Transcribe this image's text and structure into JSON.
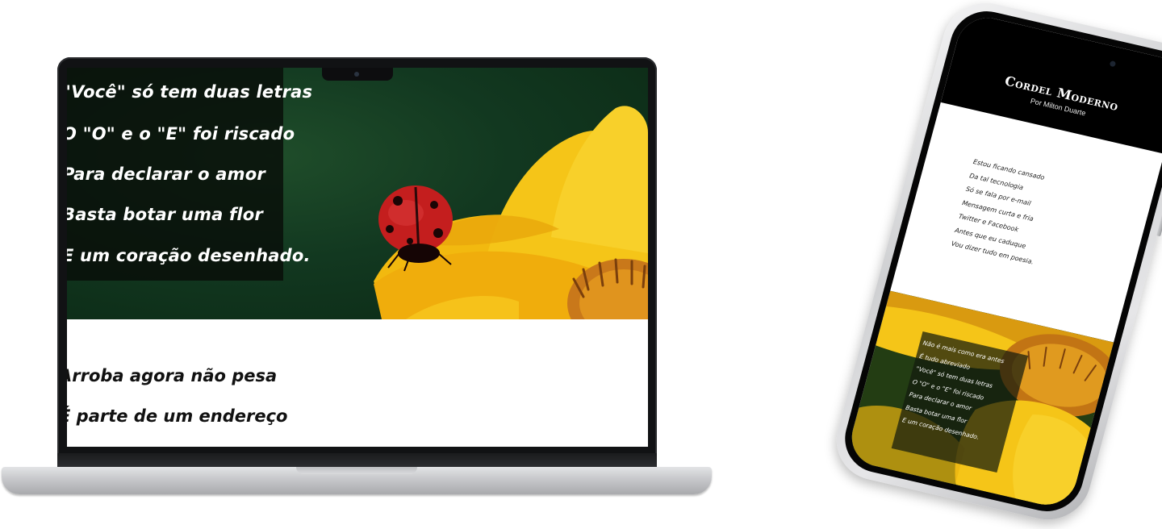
{
  "laptop": {
    "hero_poem_lines": [
      "\"Você\" só tem duas letras",
      "O \"O\" e o \"E\" foi riscado",
      "Para declarar o amor",
      "Basta botar uma flor",
      "E um coração desenhado."
    ],
    "body_lines": [
      "Arroba agora não pesa",
      "É parte de um endereço"
    ]
  },
  "phone": {
    "title": "Cordel Moderno",
    "author": "Por Milton Duarte",
    "poem_lines": [
      "Estou ficando cansado",
      "Da tal tecnologia",
      "Só se fala por e-mail",
      "Mensagem curta e fria",
      "Twitter e Facebook",
      "Antes que eu caduque",
      "Vou dizer tudo em poesia."
    ],
    "hero_poem_lines": [
      "Não é mais como era antes",
      "É tudo abreviado",
      "\"Você\" só tem duas letras",
      "O \"O\" e o \"E\" foi riscado",
      "Para declarar o amor",
      "Basta botar uma flor",
      "E um coração desenhado."
    ]
  },
  "colors": {
    "flower_yellow": "#f5c518",
    "flower_center": "#d98a1a",
    "ladybug_red": "#c41e1e",
    "background_green": "#123820",
    "device_dark": "#111214",
    "device_silver": "#c9cacd"
  }
}
